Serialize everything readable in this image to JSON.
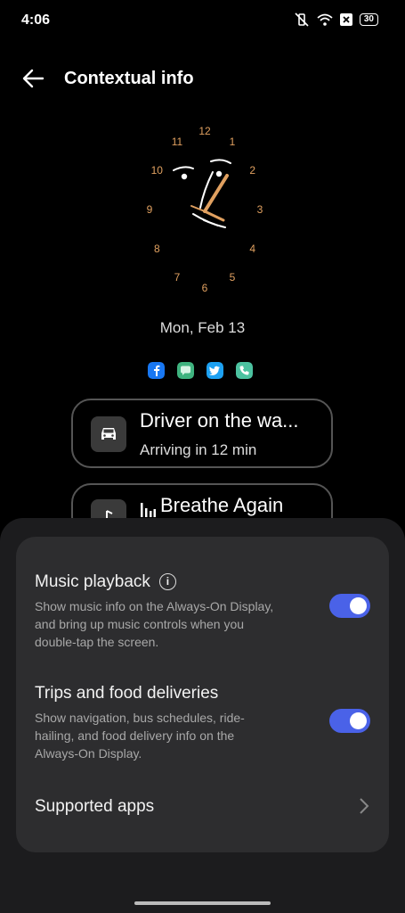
{
  "status": {
    "time": "4:06",
    "battery": "30"
  },
  "header": {
    "title": "Contextual info"
  },
  "clock": {
    "numerals": [
      "12",
      "1",
      "2",
      "3",
      "4",
      "5",
      "6",
      "7",
      "8",
      "9",
      "10",
      "11"
    ]
  },
  "lock": {
    "date": "Mon, Feb 13"
  },
  "notif_apps": [
    "facebook-icon",
    "messages-icon",
    "twitter-icon",
    "phone-icon"
  ],
  "cards": {
    "trip": {
      "title": "Driver on the wa...",
      "subtitle": "Arriving in 12 min"
    },
    "music": {
      "title": "Breathe Again"
    }
  },
  "settings": {
    "music": {
      "title": "Music playback",
      "desc": "Show music info on the Always-On Display, and bring up music controls when you double-tap the screen.",
      "enabled": true
    },
    "trips": {
      "title": "Trips and food deliveries",
      "desc": "Show navigation, bus schedules, ride-hailing, and food delivery info on the Always-On Display.",
      "enabled": true
    },
    "supported_apps": {
      "label": "Supported apps"
    }
  },
  "colors": {
    "accent": "#4a62e8",
    "clock_numerals": "#e0a060",
    "sheet": "#1c1c1e",
    "panel": "#2d2d2f"
  }
}
